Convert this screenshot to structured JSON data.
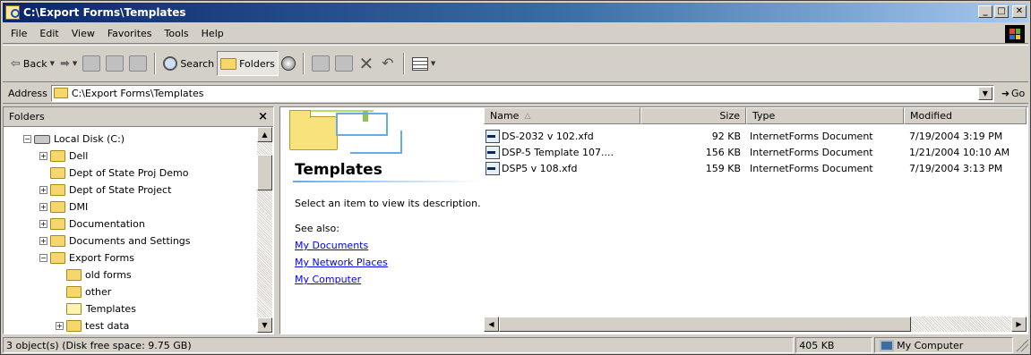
{
  "window": {
    "title": "C:\\Export Forms\\Templates"
  },
  "menubar": [
    "File",
    "Edit",
    "View",
    "Favorites",
    "Tools",
    "Help"
  ],
  "toolbar": {
    "back": "Back",
    "search": "Search",
    "folders": "Folders"
  },
  "address": {
    "label": "Address",
    "value": "C:\\Export Forms\\Templates",
    "go": "Go"
  },
  "folders_pane": {
    "title": "Folders",
    "tree": [
      {
        "label": "Local Disk (C:)",
        "level": 0,
        "expander": "minus",
        "icon": "drive-icon"
      },
      {
        "label": "Dell",
        "level": 1,
        "expander": "plus",
        "icon": "folder-icon"
      },
      {
        "label": "Dept of State Proj Demo",
        "level": 1,
        "expander": "none",
        "icon": "folder-icon"
      },
      {
        "label": "Dept of State Project",
        "level": 1,
        "expander": "plus",
        "icon": "folder-icon"
      },
      {
        "label": "DMI",
        "level": 1,
        "expander": "plus",
        "icon": "folder-icon"
      },
      {
        "label": "Documentation",
        "level": 1,
        "expander": "plus",
        "icon": "folder-icon"
      },
      {
        "label": "Documents and Settings",
        "level": 1,
        "expander": "plus",
        "icon": "folder-icon"
      },
      {
        "label": "Export Forms",
        "level": 1,
        "expander": "minus",
        "icon": "folder-icon"
      },
      {
        "label": "old forms",
        "level": 2,
        "expander": "none",
        "icon": "folder-icon"
      },
      {
        "label": "other",
        "level": 2,
        "expander": "none",
        "icon": "folder-icon"
      },
      {
        "label": "Templates",
        "level": 2,
        "expander": "none",
        "icon": "open-folder-icon",
        "selected": true
      },
      {
        "label": "test data",
        "level": 2,
        "expander": "plus",
        "icon": "folder-icon"
      }
    ]
  },
  "webview": {
    "title": "Templates",
    "description": "Select an item to view its description.",
    "see_also": "See also:",
    "links": [
      "My Documents",
      "My Network Places",
      "My Computer"
    ]
  },
  "filelist": {
    "columns": [
      "Name",
      "Size",
      "Type",
      "Modified"
    ],
    "rows": [
      {
        "name": "DS-2032 v 102.xfd",
        "size": "92 KB",
        "type": "InternetForms Document",
        "modified": "7/19/2004 3:19 PM"
      },
      {
        "name": "DSP-5 Template 107....",
        "size": "156 KB",
        "type": "InternetForms Document",
        "modified": "1/21/2004 10:10 AM"
      },
      {
        "name": "DSP5 v 108.xfd",
        "size": "159 KB",
        "type": "InternetForms Document",
        "modified": "7/19/2004 3:13 PM"
      }
    ]
  },
  "statusbar": {
    "objects": "3 object(s) (Disk free space: 9.75 GB)",
    "size": "405 KB",
    "zone": "My Computer"
  },
  "colors": {
    "titlebar_start": "#0a246a",
    "titlebar_end": "#a6caf0",
    "chrome": "#d4d0c8",
    "link": "#0000ff"
  }
}
